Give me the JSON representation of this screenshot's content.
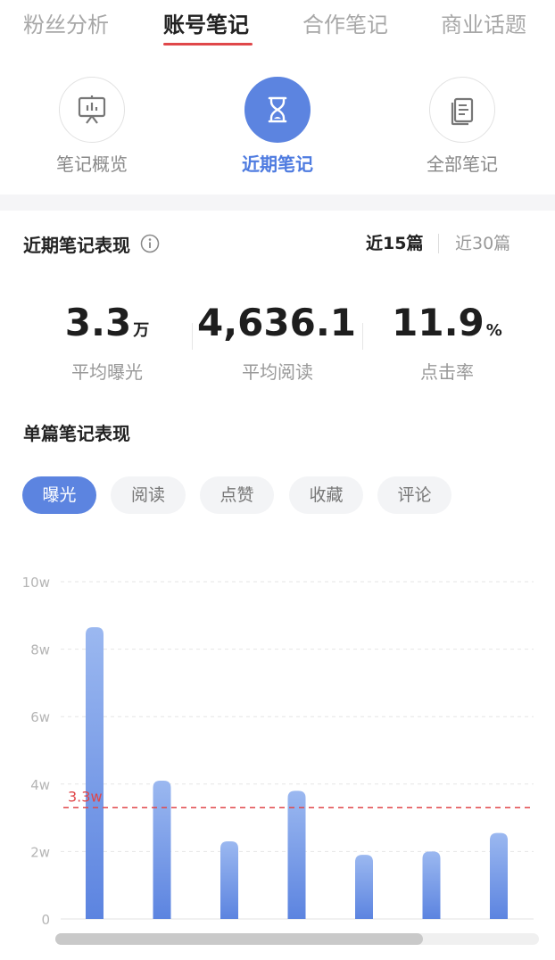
{
  "top_tabs": [
    {
      "label": "粉丝分析",
      "active": false
    },
    {
      "label": "账号笔记",
      "active": true
    },
    {
      "label": "合作笔记",
      "active": false
    },
    {
      "label": "商业话题",
      "active": false
    }
  ],
  "sub_nav": [
    {
      "label": "笔记概览",
      "icon": "presentation-board-icon",
      "active": false
    },
    {
      "label": "近期笔记",
      "icon": "hourglass-icon",
      "active": true
    },
    {
      "label": "全部笔记",
      "icon": "documents-icon",
      "active": false
    }
  ],
  "recent": {
    "title": "近期笔记表现",
    "range_options": [
      "近15篇",
      "近30篇"
    ],
    "selected_range": "近15篇",
    "stats": [
      {
        "value": "3.3",
        "unit": "万",
        "label": "平均曝光"
      },
      {
        "value": "4,636.1",
        "unit": "",
        "label": "平均阅读"
      },
      {
        "value": "11.9",
        "unit": "%",
        "label": "点击率"
      }
    ]
  },
  "single": {
    "title": "单篇笔记表现",
    "metric_tabs": [
      "曝光",
      "阅读",
      "点赞",
      "收藏",
      "评论"
    ],
    "selected_metric": "曝光"
  },
  "colors": {
    "accent": "#5c84e0",
    "tab_underline": "#e0474a",
    "average_line": "#e0474a",
    "bar_top": "#9bb8f0",
    "bar_bottom": "#5c84e0"
  },
  "chart_data": {
    "type": "bar",
    "y_tick_labels": [
      "0",
      "2w",
      "4w",
      "6w",
      "8w",
      "10w"
    ],
    "ylim": [
      0,
      100000
    ],
    "values": [
      86500,
      41000,
      23000,
      38000,
      19000,
      20000,
      25500
    ],
    "average_line": {
      "value": 33000,
      "label": "3.3w"
    },
    "grid": true,
    "scrollbar_visible_fraction": 0.76
  }
}
